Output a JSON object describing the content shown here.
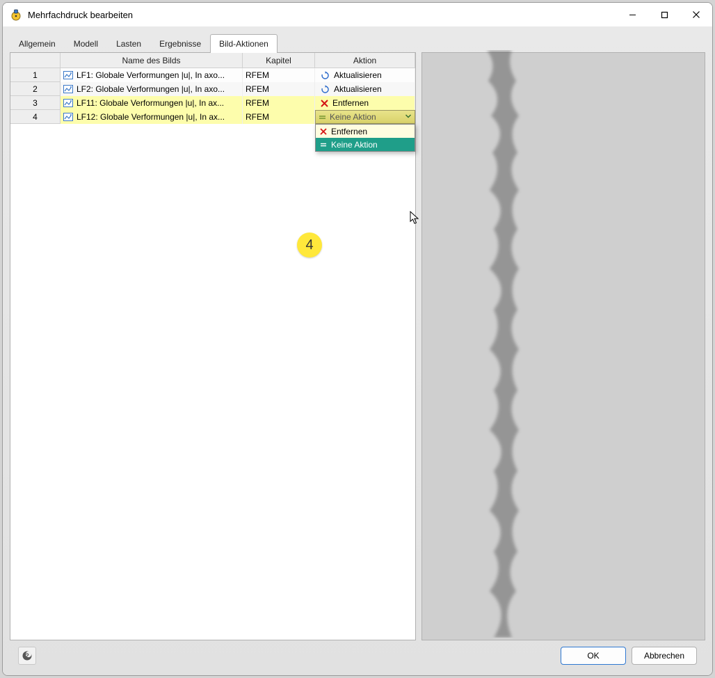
{
  "window": {
    "title": "Mehrfachdruck bearbeiten",
    "minimize_btn": "minimize",
    "maximize_btn": "maximize",
    "close_btn": "close"
  },
  "tabs": [
    {
      "label": "Allgemein",
      "active": false
    },
    {
      "label": "Modell",
      "active": false
    },
    {
      "label": "Lasten",
      "active": false
    },
    {
      "label": "Ergebnisse",
      "active": false
    },
    {
      "label": "Bild-Aktionen",
      "active": true
    }
  ],
  "grid": {
    "headers": {
      "number": "",
      "name": "Name des Bilds",
      "chapter": "Kapitel",
      "action": "Aktion"
    },
    "rows": [
      {
        "num": "1",
        "name": "LF1: Globale Verformungen |u|, In axo...",
        "chapter": "RFEM",
        "action_type": "refresh",
        "action_label": "Aktualisieren"
      },
      {
        "num": "2",
        "name": "LF2: Globale Verformungen |u|, In axo...",
        "chapter": "RFEM",
        "action_type": "refresh",
        "action_label": "Aktualisieren"
      },
      {
        "num": "3",
        "name": "LF11: Globale Verformungen |u|, In ax...",
        "chapter": "RFEM",
        "action_type": "remove",
        "action_label": "Entfernen"
      },
      {
        "num": "4",
        "name": "LF12: Globale Verformungen |u|, In ax...",
        "chapter": "RFEM",
        "action_type": "dropdown",
        "action_label": "Keine Aktion"
      }
    ]
  },
  "dropdown": {
    "selected": "Keine Aktion",
    "items": [
      {
        "icon": "remove",
        "label": "Entfernen",
        "highlight": false
      },
      {
        "icon": "noaction",
        "label": "Keine Aktion",
        "highlight": true
      }
    ]
  },
  "badge": {
    "label": "4"
  },
  "footer": {
    "help": "help",
    "ok": "OK",
    "cancel": "Abbrechen"
  }
}
